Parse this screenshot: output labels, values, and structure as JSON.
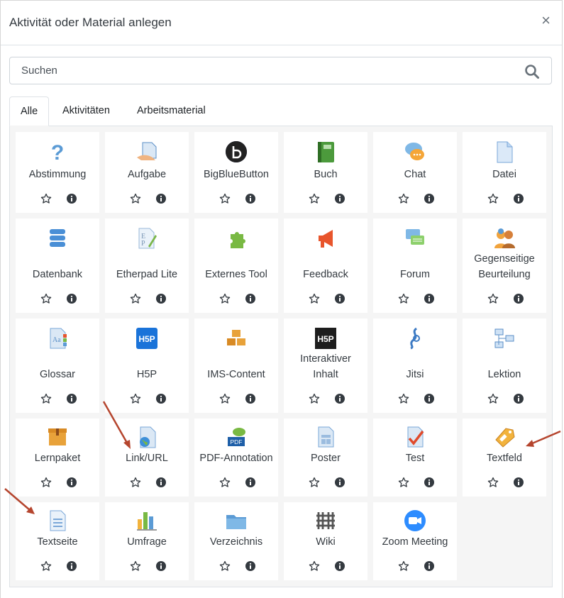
{
  "dialog": {
    "title": "Aktivität oder Material anlegen",
    "close": "×",
    "search_placeholder": "Suchen"
  },
  "tabs": [
    "Alle",
    "Aktivitäten",
    "Arbeitsmaterial"
  ],
  "items": [
    {
      "label": "Abstimmung",
      "icon": "question-icon"
    },
    {
      "label": "Aufgabe",
      "icon": "assignment-icon"
    },
    {
      "label": "BigBlueButton",
      "icon": "bigbluebutton-icon"
    },
    {
      "label": "Buch",
      "icon": "book-icon"
    },
    {
      "label": "Chat",
      "icon": "chat-icon"
    },
    {
      "label": "Datei",
      "icon": "file-icon"
    },
    {
      "label": "Datenbank",
      "icon": "database-icon"
    },
    {
      "label": "Etherpad Lite",
      "icon": "etherpad-icon"
    },
    {
      "label": "Externes Tool",
      "icon": "puzzle-icon"
    },
    {
      "label": "Feedback",
      "icon": "megaphone-icon"
    },
    {
      "label": "Forum",
      "icon": "forum-icon"
    },
    {
      "label": "Gegenseitige Beurteilung",
      "icon": "workshop-icon"
    },
    {
      "label": "Glossar",
      "icon": "glossary-icon"
    },
    {
      "label": "H5P",
      "icon": "h5p-icon"
    },
    {
      "label": "IMS-Content",
      "icon": "ims-boxes-icon"
    },
    {
      "label": "Interaktiver Inhalt",
      "icon": "h5p-dark-icon"
    },
    {
      "label": "Jitsi",
      "icon": "jitsi-icon"
    },
    {
      "label": "Lektion",
      "icon": "lesson-icon"
    },
    {
      "label": "Lernpaket",
      "icon": "package-icon"
    },
    {
      "label": "Link/URL",
      "icon": "url-globe-icon"
    },
    {
      "label": "PDF-Annotation",
      "icon": "pdf-annotation-icon"
    },
    {
      "label": "Poster",
      "icon": "poster-icon"
    },
    {
      "label": "Test",
      "icon": "quiz-icon"
    },
    {
      "label": "Textfeld",
      "icon": "label-tag-icon"
    },
    {
      "label": "Textseite",
      "icon": "page-icon"
    },
    {
      "label": "Umfrage",
      "icon": "survey-chart-icon"
    },
    {
      "label": "Verzeichnis",
      "icon": "folder-icon"
    },
    {
      "label": "Wiki",
      "icon": "wiki-icon"
    },
    {
      "label": "Zoom Meeting",
      "icon": "zoom-icon"
    }
  ]
}
